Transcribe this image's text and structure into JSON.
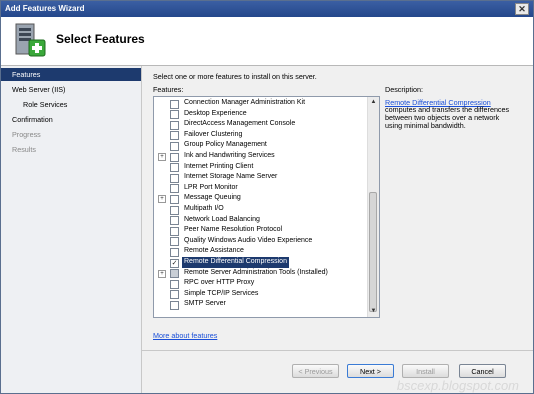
{
  "window": {
    "title": "Add Features Wizard"
  },
  "header": {
    "title": "Select Features"
  },
  "nav": {
    "items": [
      {
        "label": "Features",
        "state": "active",
        "level": 0
      },
      {
        "label": "Web Server (IIS)",
        "state": "normal",
        "level": 0
      },
      {
        "label": "Role Services",
        "state": "normal",
        "level": 1
      },
      {
        "label": "Confirmation",
        "state": "normal",
        "level": 0
      },
      {
        "label": "Progress",
        "state": "disabled",
        "level": 0
      },
      {
        "label": "Results",
        "state": "disabled",
        "level": 0
      }
    ]
  },
  "main": {
    "instruction": "Select one or more features to install on this server.",
    "features_label": "Features:",
    "description_label": "Description:",
    "description_link": "Remote Differential Compression",
    "description_text": "computes and transfers the differences between two objects over a network using minimal bandwidth.",
    "more_link": "More about features"
  },
  "features": [
    {
      "label": "Connection Manager Administration Kit",
      "checked": false,
      "expander": false
    },
    {
      "label": "Desktop Experience",
      "checked": false,
      "expander": false
    },
    {
      "label": "DirectAccess Management Console",
      "checked": false,
      "expander": false
    },
    {
      "label": "Failover Clustering",
      "checked": false,
      "expander": false
    },
    {
      "label": "Group Policy Management",
      "checked": false,
      "expander": false
    },
    {
      "label": "Ink and Handwriting Services",
      "checked": false,
      "expander": true
    },
    {
      "label": "Internet Printing Client",
      "checked": false,
      "expander": false
    },
    {
      "label": "Internet Storage Name Server",
      "checked": false,
      "expander": false
    },
    {
      "label": "LPR Port Monitor",
      "checked": false,
      "expander": false
    },
    {
      "label": "Message Queuing",
      "checked": false,
      "expander": true
    },
    {
      "label": "Multipath I/O",
      "checked": false,
      "expander": false
    },
    {
      "label": "Network Load Balancing",
      "checked": false,
      "expander": false
    },
    {
      "label": "Peer Name Resolution Protocol",
      "checked": false,
      "expander": false
    },
    {
      "label": "Quality Windows Audio Video Experience",
      "checked": false,
      "expander": false
    },
    {
      "label": "Remote Assistance",
      "checked": false,
      "expander": false
    },
    {
      "label": "Remote Differential Compression",
      "checked": true,
      "expander": false,
      "selected": true
    },
    {
      "label": "Remote Server Administration Tools  (Installed)",
      "checked": "partial",
      "expander": true
    },
    {
      "label": "RPC over HTTP Proxy",
      "checked": false,
      "expander": false
    },
    {
      "label": "Simple TCP/IP Services",
      "checked": false,
      "expander": false
    },
    {
      "label": "SMTP Server",
      "checked": false,
      "expander": false
    }
  ],
  "buttons": {
    "previous": "< Previous",
    "next": "Next >",
    "install": "Install",
    "cancel": "Cancel"
  },
  "watermark": "bscexp.blogspot.com",
  "colors": {
    "accent": "#1d3a6e",
    "link": "#1a4fd8",
    "titlebar": "#2c4f94"
  }
}
